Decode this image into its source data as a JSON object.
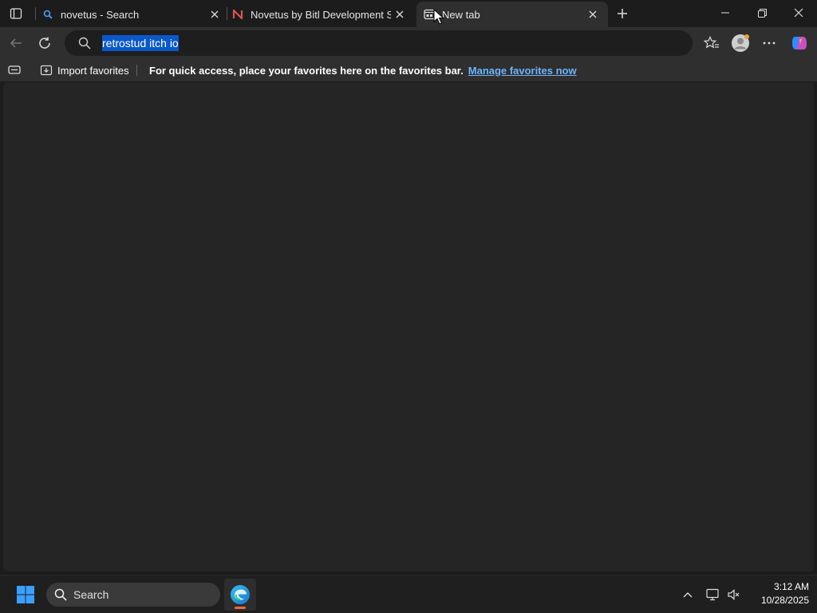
{
  "browser": {
    "tabs": [
      {
        "title": "novetus - Search",
        "favicon": "search-icon",
        "active": false
      },
      {
        "title": "Novetus by Bitl Development Studio",
        "favicon": "novetus-logo-icon",
        "active": false
      },
      {
        "title": "New tab",
        "favicon": "new-tab-icon",
        "active": true
      }
    ],
    "address_bar": {
      "value": "retrostud itch io"
    },
    "favorites_bar": {
      "import_label": "Import favorites",
      "message": "For quick access, place your favorites here on the favorites bar.",
      "manage_link": "Manage favorites now"
    }
  },
  "taskbar": {
    "search_placeholder": "Search",
    "time": "3:12 AM",
    "date": "10/28/2025"
  },
  "colors": {
    "accent_selection": "#0a58ca",
    "link": "#6fb3ff",
    "edge_indicator": "#e86a3a"
  }
}
